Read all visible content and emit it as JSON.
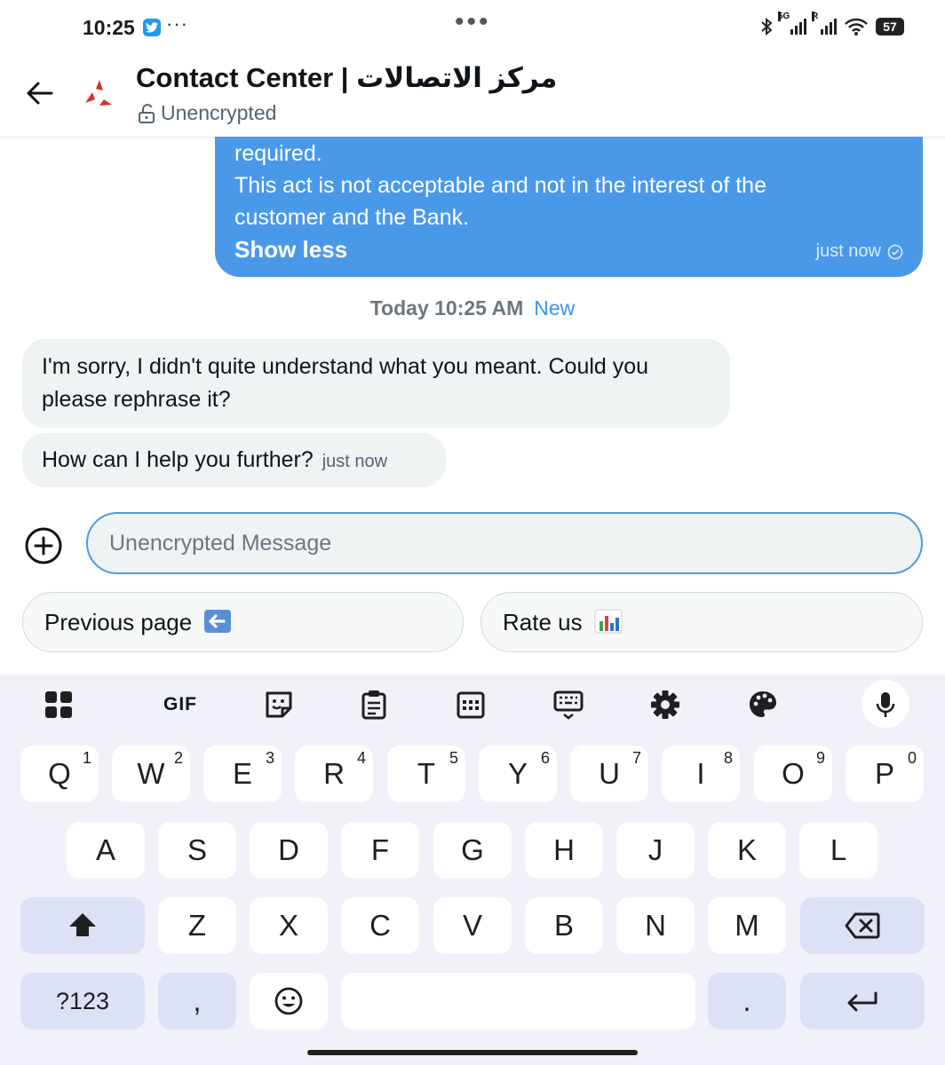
{
  "status_bar": {
    "time": "10:25",
    "notification_dots": "···",
    "center_dots": "•••",
    "network_label_1": "5G",
    "network_label_2": "R",
    "battery": "57"
  },
  "header": {
    "title": "Contact Center | مركز الاتصالات",
    "subtitle": "Unencrypted"
  },
  "messages": {
    "sent": {
      "lines": [
        "required.",
        "This act is not acceptable and not in the interest of the",
        "customer and the Bank."
      ],
      "show_less": "Show less",
      "time": "just now"
    },
    "date_separator": "Today 10:25 AM",
    "new_label": "New",
    "received": [
      {
        "text": "I'm sorry, I didn't quite understand what you meant. Could you please rephrase it?"
      },
      {
        "text": "How can I help you further?",
        "time": "just now"
      }
    ]
  },
  "composer": {
    "placeholder": "Unencrypted Message"
  },
  "quick_replies": [
    {
      "label": "Previous page",
      "emoji": "⬅️"
    },
    {
      "label": "Rate us",
      "emoji": "📊"
    }
  ],
  "keyboard": {
    "toolbar": [
      "apps-icon",
      "gif-icon",
      "sticker-icon",
      "clipboard-icon",
      "one-handed-icon",
      "keyboard-layout-icon",
      "settings-icon",
      "theme-icon",
      "mic-icon"
    ],
    "gif_label": "GIF",
    "row1": [
      {
        "k": "Q",
        "n": "1"
      },
      {
        "k": "W",
        "n": "2"
      },
      {
        "k": "E",
        "n": "3"
      },
      {
        "k": "R",
        "n": "4"
      },
      {
        "k": "T",
        "n": "5"
      },
      {
        "k": "Y",
        "n": "6"
      },
      {
        "k": "U",
        "n": "7"
      },
      {
        "k": "I",
        "n": "8"
      },
      {
        "k": "O",
        "n": "9"
      },
      {
        "k": "P",
        "n": "0"
      }
    ],
    "row2": [
      "A",
      "S",
      "D",
      "F",
      "G",
      "H",
      "J",
      "K",
      "L"
    ],
    "row3": [
      "Z",
      "X",
      "C",
      "V",
      "B",
      "N",
      "M"
    ],
    "symbols_key": "?123",
    "comma_key": ",",
    "period_key": ".",
    "colors": {
      "accent": "#4a99e9",
      "keyboard_bg": "#f0f1f9",
      "function_key": "#dde1f6",
      "logo_red": "#d9342b"
    }
  }
}
